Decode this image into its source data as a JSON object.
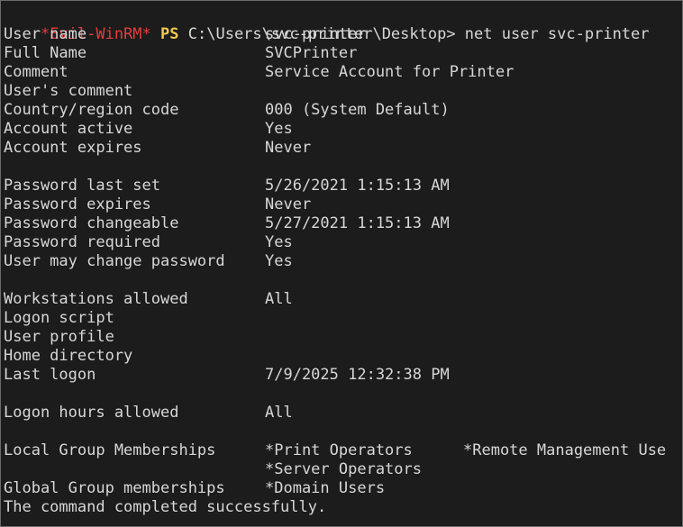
{
  "colors": {
    "background": "#1c1c1c",
    "text": "#d7d7d7",
    "shell_prompt": "#e63c3c",
    "ps_prompt": "#f2c94c"
  },
  "prompt": {
    "shell": "*Evil-WinRM*",
    "ps": "PS",
    "path_command": "C:\\Users\\svc-printer\\Desktop> net user svc-printer"
  },
  "fields": {
    "user_name": {
      "label": "User name",
      "value": "svc-printer"
    },
    "full_name": {
      "label": "Full Name",
      "value": "SVCPrinter"
    },
    "comment": {
      "label": "Comment",
      "value": "Service Account for Printer"
    },
    "users_comment": {
      "label": "User's comment",
      "value": ""
    },
    "country_code": {
      "label": "Country/region code",
      "value": "000 (System Default)"
    },
    "account_active": {
      "label": "Account active",
      "value": "Yes"
    },
    "account_expires": {
      "label": "Account expires",
      "value": "Never"
    },
    "password_last_set": {
      "label": "Password last set",
      "value": "5/26/2021 1:15:13 AM"
    },
    "password_expires": {
      "label": "Password expires",
      "value": "Never"
    },
    "password_changeable": {
      "label": "Password changeable",
      "value": "5/27/2021 1:15:13 AM"
    },
    "password_required": {
      "label": "Password required",
      "value": "Yes"
    },
    "user_may_change_password": {
      "label": "User may change password",
      "value": "Yes"
    },
    "workstations_allowed": {
      "label": "Workstations allowed",
      "value": "All"
    },
    "logon_script": {
      "label": "Logon script",
      "value": ""
    },
    "user_profile": {
      "label": "User profile",
      "value": ""
    },
    "home_directory": {
      "label": "Home directory",
      "value": ""
    },
    "last_logon": {
      "label": "Last logon",
      "value": "7/9/2025 12:32:38 PM"
    },
    "logon_hours_allowed": {
      "label": "Logon hours allowed",
      "value": "All"
    },
    "local_groups": {
      "label": "Local Group Memberships",
      "values": [
        "*Print Operators",
        "*Remote Management Use",
        "*Server Operators"
      ]
    },
    "global_groups": {
      "label": "Global Group memberships",
      "value": "*Domain Users"
    }
  },
  "footer": {
    "status": "The command completed successfully."
  }
}
